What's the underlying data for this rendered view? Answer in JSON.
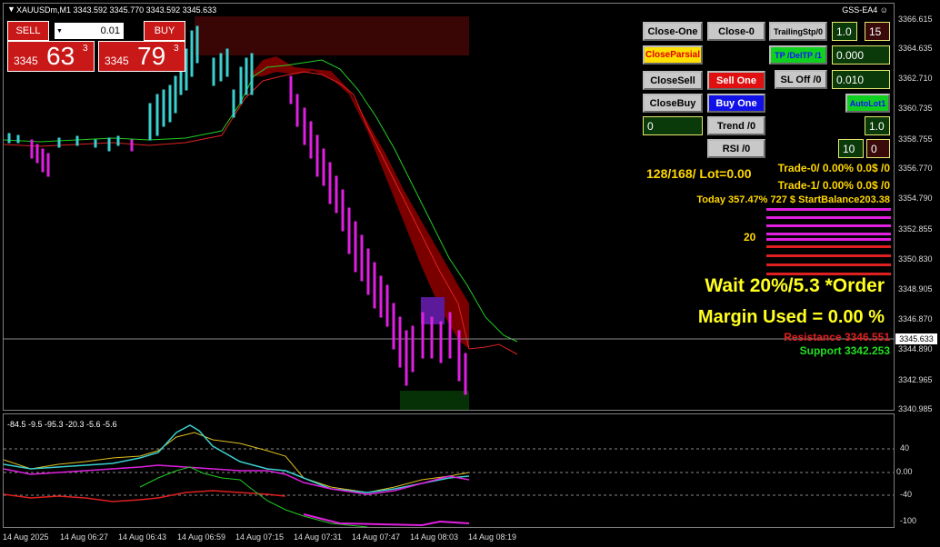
{
  "header": {
    "symbol_info": "XAUUSDm,M1  3343.592 3345.770 3343.592 3345.633",
    "ea_name": "GSS-EA4"
  },
  "trade_panel": {
    "sell_label": "SELL",
    "buy_label": "BUY",
    "lot_value": "0.01",
    "sell_price_small": "3345",
    "sell_price_big": "63",
    "sell_price_sup": "3",
    "buy_price_small": "3345",
    "buy_price_big": "79",
    "buy_price_sup": "3"
  },
  "price_axis": [
    "3366.615",
    "3364.635",
    "3362.710",
    "3360.735",
    "3358.755",
    "3356.770",
    "3354.790",
    "3352.855",
    "3350.830",
    "3348.905",
    "3346.870",
    "3344.890",
    "3342.965",
    "3340.985"
  ],
  "current_price": "3345.633",
  "sub_axis": [
    "40",
    "0.00",
    "-40",
    "-100"
  ],
  "sub_header": "-84.5 -9.5 -95.3 -20.3 -5.6 -5.6",
  "time_axis": [
    "14 Aug 2025",
    "14 Aug 06:27",
    "14 Aug 06:43",
    "14 Aug 06:59",
    "14 Aug 07:15",
    "14 Aug 07:31",
    "14 Aug 07:47",
    "14 Aug 08:03",
    "14 Aug 08:19"
  ],
  "buttons": {
    "close_one": "Close-One",
    "close_0": "Close-0",
    "trailing": "TrailingStp/0",
    "trailing_val": "1.0",
    "trailing_val2": "15",
    "close_parsial": "CloseParsial",
    "tp_del": "TP /DelTP /1",
    "tp_val": "0.000",
    "close_sell": "CloseSell",
    "sell_one": "Sell One",
    "sl_off": "SL Off /0",
    "sl_val": "0.010",
    "close_buy": "CloseBuy",
    "buy_one": "Buy One",
    "auto_lot": "AutoLot1",
    "field_zero": "0",
    "trend": "Trend /0",
    "auto_val": "1.0",
    "rsi": "RSI /0",
    "rsi_val": "10",
    "rsi_val2": "0"
  },
  "info": {
    "lot_line": "128/168/ Lot=0.00",
    "trade0": "Trade-0/ 0.00% 0.0$ /0",
    "trade1": "Trade-1/ 0.00% 0.0$  /0",
    "today": "Today 357.47% 727 $ StartBalance203.38",
    "twenty": "20",
    "wait": "Wait 20%/5.3 *Order",
    "margin": "Margin Used = 0.00 %",
    "resistance": "Resistance 3346.551",
    "support": "Support 3342.253"
  },
  "colors": {
    "yellow": "#ffd700",
    "magenta": "#e020e0",
    "red": "#e02020",
    "green": "#22dd22"
  }
}
